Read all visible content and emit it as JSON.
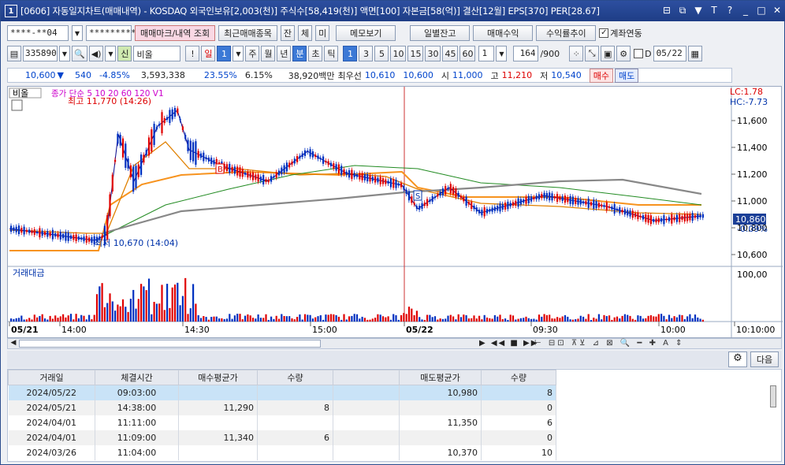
{
  "window": {
    "number": "1",
    "title": "[0606] 자동일지차트(매매내역) - KOSDAQ 외국인보유[2,003(천)] 주식수[58,419(천)] 액면[100] 자본금[58(억)] 결산[12월] EPS[370] PER[28.67]",
    "controls": [
      "⊟",
      "⧉",
      "▼",
      "T",
      "?",
      "_",
      "□",
      "✕"
    ]
  },
  "toolbar1": {
    "account": "****-**04",
    "password": "*********",
    "buttons": [
      "매매마크/내역 조회",
      "최근매매종목",
      "잔",
      "체",
      "미",
      "메모보기",
      "일별잔고",
      "매매수익",
      "수익률추이"
    ],
    "checkbox_label": "계좌연동",
    "checkbox_checked": true
  },
  "toolbar2": {
    "code": "335890",
    "badge": "신",
    "name": "비올",
    "period_buttons": [
      "일",
      "1",
      "주",
      "월",
      "년",
      "분",
      "초",
      "틱"
    ],
    "minute_buttons": [
      "1",
      "3",
      "5",
      "10",
      "15",
      "30",
      "45",
      "60"
    ],
    "count_select": "1",
    "count": "164",
    "count_total": "/900",
    "date_checkbox": "D",
    "date": "05/22"
  },
  "quote": {
    "price": "10,600",
    "arrow": "▼",
    "change": "540",
    "change_pct": "-4.85%",
    "volume": "3,593,338",
    "vol_ratio": "23.55%",
    "turnover": "6.15%",
    "amount": "38,920백만",
    "best_label": "최우선",
    "best_bid": "10,610",
    "best_ask": "10,600",
    "open_label": "시",
    "open": "11,000",
    "high_label": "고",
    "high": "11,210",
    "low_label": "저",
    "low": "10,540",
    "buy": "매수",
    "sell": "매도"
  },
  "chart_labels": {
    "stock": "비올",
    "legend": "종가 단순 5 10 20 60 120 V1",
    "high_marker": "최고 11,770 (14:26)",
    "low_marker": "최저 10,670 (14:04)",
    "lc": "LC:1.78",
    "hc": "HC:-7.73",
    "current": "10,860",
    "current_pct": "-0.09%",
    "volume_title": "거래대금",
    "buy_mark": "B",
    "sell_mark": "S"
  },
  "chart_data": {
    "type": "line",
    "y_ticks": [
      "11,600",
      "11,400",
      "11,200",
      "11,000",
      "10,800",
      "10,600"
    ],
    "volume_tick": "100,00",
    "x_ticks": [
      "05/21",
      "14:00",
      "14:30",
      "15:00",
      "05/22",
      "09:30",
      "10:00",
      "10:10:00"
    ],
    "ylim": [
      10540,
      11800
    ]
  },
  "bottom": {
    "next_button": "다음"
  },
  "table": {
    "headers": [
      "거래일",
      "체결시간",
      "매수평균가",
      "수량",
      "",
      "매도평균가",
      "수량"
    ],
    "rows": [
      [
        "2024/05/22",
        "09:03:00",
        "",
        "",
        "",
        "10,980",
        "8"
      ],
      [
        "2024/05/21",
        "14:38:00",
        "11,290",
        "8",
        "",
        "",
        "0"
      ],
      [
        "2024/04/01",
        "11:11:00",
        "",
        "",
        "",
        "11,350",
        "6"
      ],
      [
        "2024/04/01",
        "11:09:00",
        "11,340",
        "6",
        "",
        "",
        "0"
      ],
      [
        "2024/03/26",
        "11:04:00",
        "",
        "",
        "",
        "10,370",
        "10"
      ]
    ]
  }
}
